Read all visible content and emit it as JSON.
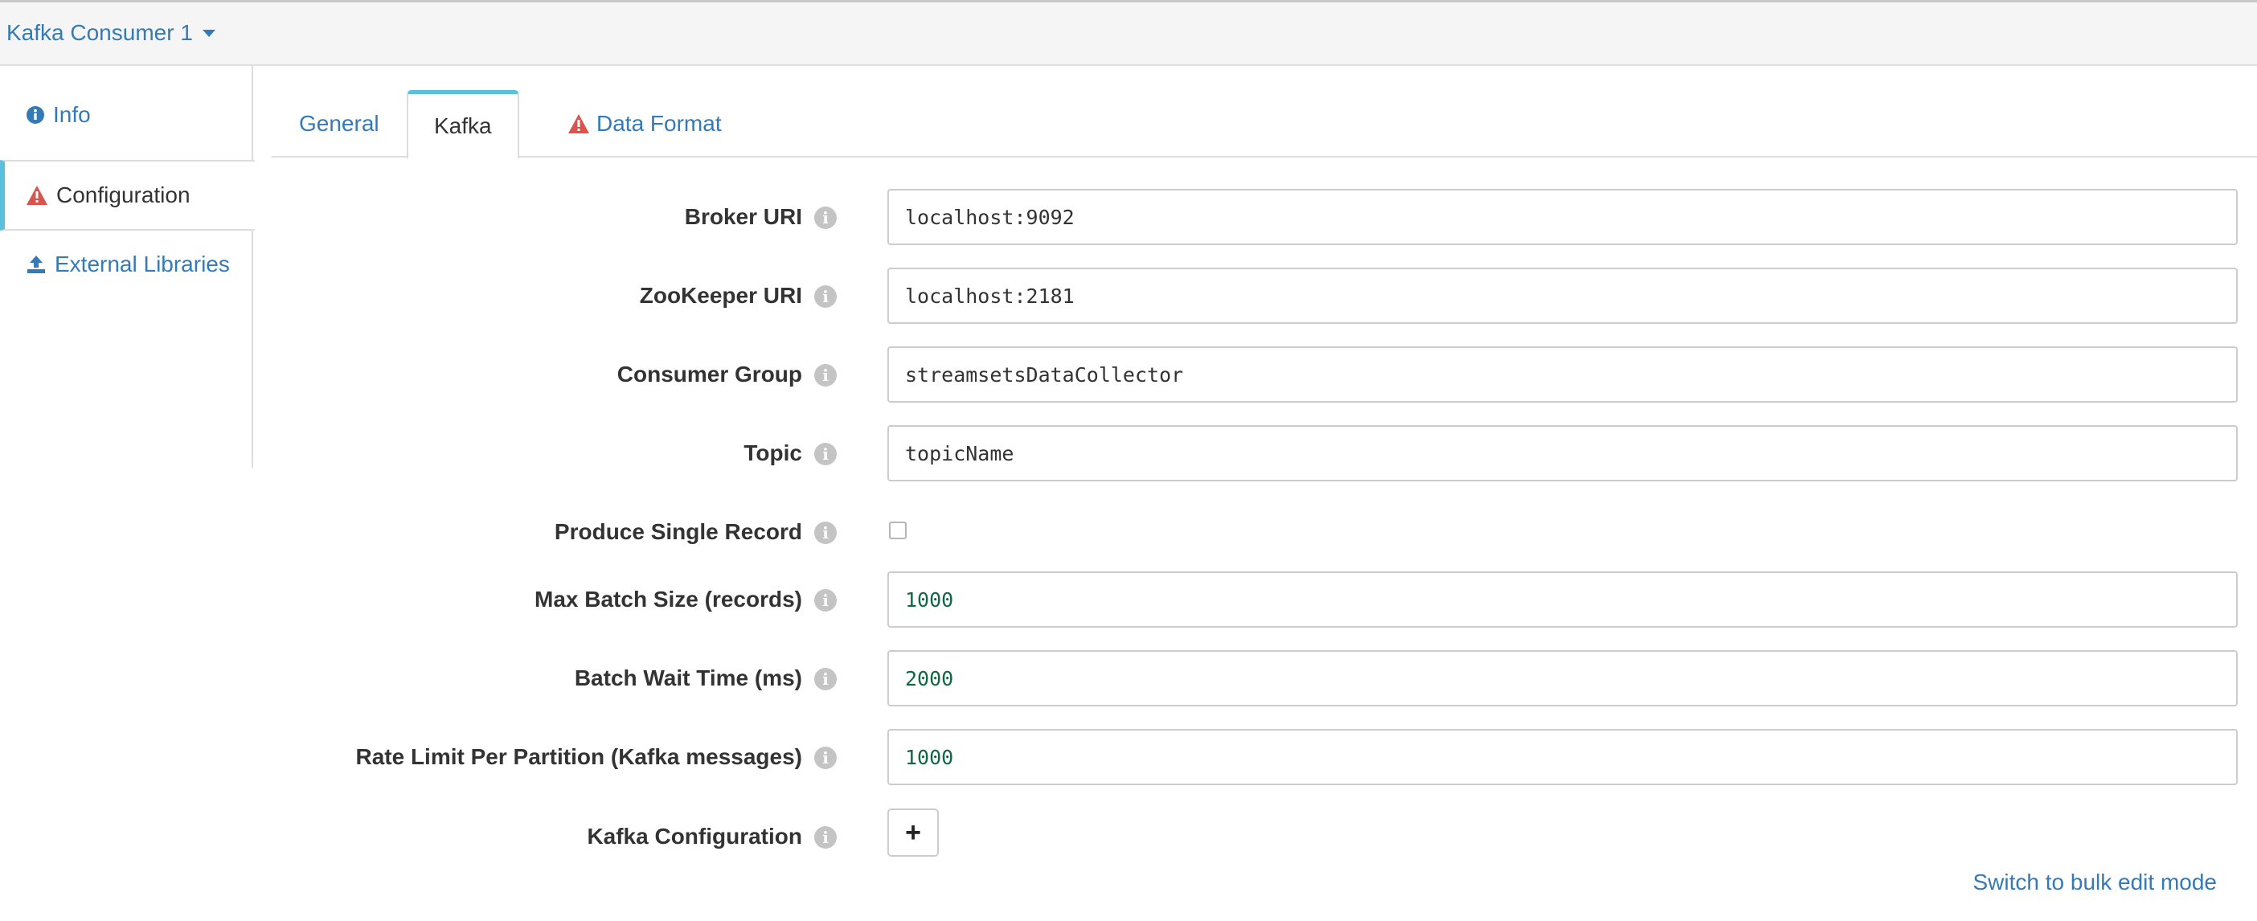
{
  "header": {
    "stage_name": "Kafka Consumer 1"
  },
  "sidebar": {
    "items": [
      {
        "label": "Info",
        "icon": "info-circle-icon"
      },
      {
        "label": "Configuration",
        "icon": "warning-triangle-icon"
      },
      {
        "label": "External Libraries",
        "icon": "upload-icon"
      }
    ],
    "active": "Configuration"
  },
  "tabs": {
    "items": [
      {
        "label": "General"
      },
      {
        "label": "Kafka"
      },
      {
        "label": "Data Format",
        "icon": "warning-triangle-icon"
      }
    ],
    "active": "Kafka"
  },
  "form": {
    "broker_uri": {
      "label": "Broker URI",
      "value": "localhost:9092"
    },
    "zookeeper_uri": {
      "label": "ZooKeeper URI",
      "value": "localhost:2181"
    },
    "consumer_group": {
      "label": "Consumer Group",
      "value": "streamsetsDataCollector"
    },
    "topic": {
      "label": "Topic",
      "value": "topicName"
    },
    "produce_single_record": {
      "label": "Produce Single Record",
      "checked": false
    },
    "max_batch_size": {
      "label": "Max Batch Size (records)",
      "value": "1000"
    },
    "batch_wait_time": {
      "label": "Batch Wait Time (ms)",
      "value": "2000"
    },
    "rate_limit": {
      "label": "Rate Limit Per Partition (Kafka messages)",
      "value": "1000"
    },
    "kafka_configuration": {
      "label": "Kafka Configuration",
      "add_label": "+"
    }
  },
  "bulk_edit_link": "Switch to bulk edit mode",
  "colors": {
    "link": "#337ab7",
    "warning": "#d9534f",
    "active_tab_accent": "#5bc0de",
    "numeric_value": "#116644"
  }
}
